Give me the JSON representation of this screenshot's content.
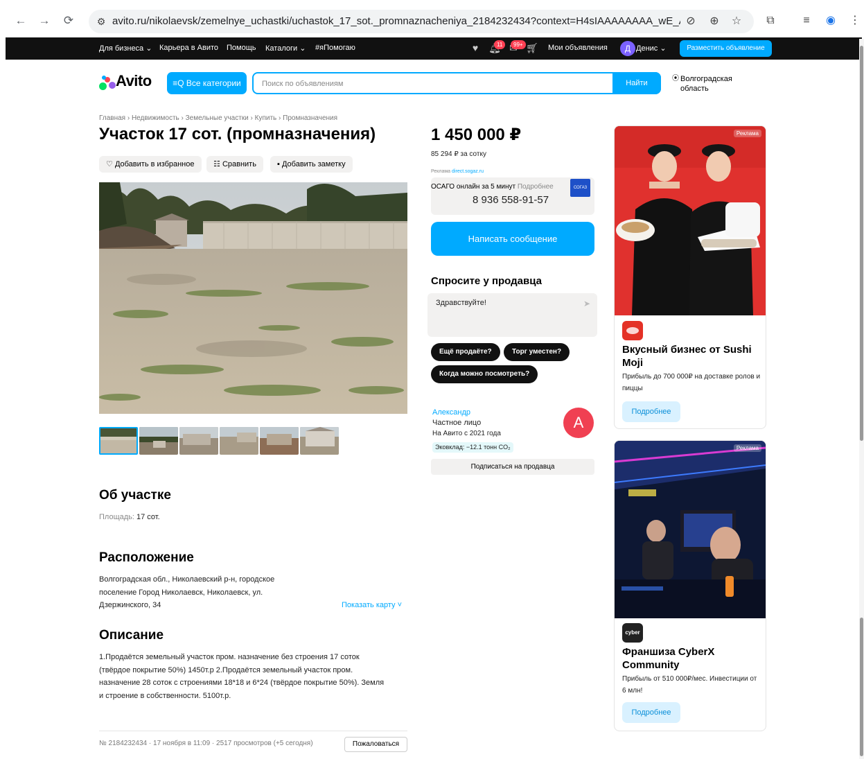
{
  "browser": {
    "url": "avito.ru/nikolaevsk/zemelnye_uchastki/uchastok_17_sot._promnaznacheniya_2184232434?context=H4sIAAAAAAAA_wE_AMD_YToyOnt..."
  },
  "topbar": {
    "business": "Для бизнеса ⌄",
    "career": "Карьера в Авито",
    "help": "Помощь",
    "catalogs": "Каталоги ⌄",
    "ihelp": "#яПомогаю",
    "notif_badge": "11",
    "msg_badge": "99+",
    "my_ads": "Мои объявления",
    "avatar_letter": "Д",
    "user_name": "Денис ⌄",
    "post_button": "Разместить объявление"
  },
  "header": {
    "logo": "Avito",
    "categories_button": "≡Q Все категории",
    "search_placeholder": "Поиск по объявлениям",
    "search_button": "Найти",
    "region": "Волгоградская область"
  },
  "breadcrumbs": "Главная › Недвижимость › Земельные участки › Купить › Промназначения",
  "listing": {
    "title": "Участок 17 сот. (промназначения)",
    "actions": {
      "favorite": "Добавить в избранное",
      "compare": "Сравнить",
      "note": "Добавить заметку"
    },
    "price": "1 450 000 ₽",
    "price_per_unit": "85 294 ₽ за сотку"
  },
  "ad_osago": {
    "label": "Реклама",
    "domain": "direct.sogaz.ru",
    "text": "ОСАГО онлайн за 5 минут",
    "more": "Подробнее",
    "phone": "8 936 558-91-57",
    "brand": "СОГАЗ"
  },
  "contact": {
    "message_button": "Написать сообщение",
    "ask_title": "Спросите у продавца",
    "ask_value": "Здравствуйте!",
    "chips": [
      "Ещё продаёте?",
      "Торг уместен?",
      "Когда можно посмотреть?"
    ]
  },
  "seller": {
    "name": "Александр",
    "type": "Частное лицо",
    "since": "На Авито с 2021 года",
    "eco": "Эковклад: −12.1 тонн CO₂",
    "avatar_letter": "А",
    "subscribe": "Подписаться на продавца"
  },
  "about": {
    "heading": "Об участке",
    "area_label": "Площадь:",
    "area_value": "17 сот."
  },
  "location": {
    "heading": "Расположение",
    "address": "Волгоградская обл., Николаевский р-н, городское поселение Город Николаевск, Николаевск, ул. Дзержинского, 34",
    "map_button": "Показать карту ˅"
  },
  "description": {
    "heading": "Описание",
    "text": "1.Продаётся земельный участок пром. назначение без строения 17 соток (твёрдое покрытие 50%) 1450т.р 2.Продаётся земельный участок пром. назначение 28 соток с строениями 18*18 и 6*24 (твёрдое покрытие 50%). Земля и строение в собственности. 5100т.р."
  },
  "footer_meta": {
    "info": "№ 2184232434 · 17 ноября в 11:09 · 2517 просмотров (+5 сегодня)",
    "complain": "Пожаловаться"
  },
  "ads": [
    {
      "label": "Реклама",
      "title": "Вкусный бизнес от Sushi Moji",
      "desc": "Прибыль до 700 000₽ на доставке ролов и пиццы",
      "button": "Подробнее"
    },
    {
      "label": "Реклама",
      "title": "Франшиза CyberX Community",
      "desc": "Прибыль от 510 000₽/мес. Инвестиции от 6 млн!",
      "button": "Подробнее",
      "logo_text": "cyber"
    }
  ],
  "colors": {
    "accent": "#00aaff",
    "dark": "#111111",
    "badge": "#ff4053",
    "avatar_seller": "#f04052"
  }
}
